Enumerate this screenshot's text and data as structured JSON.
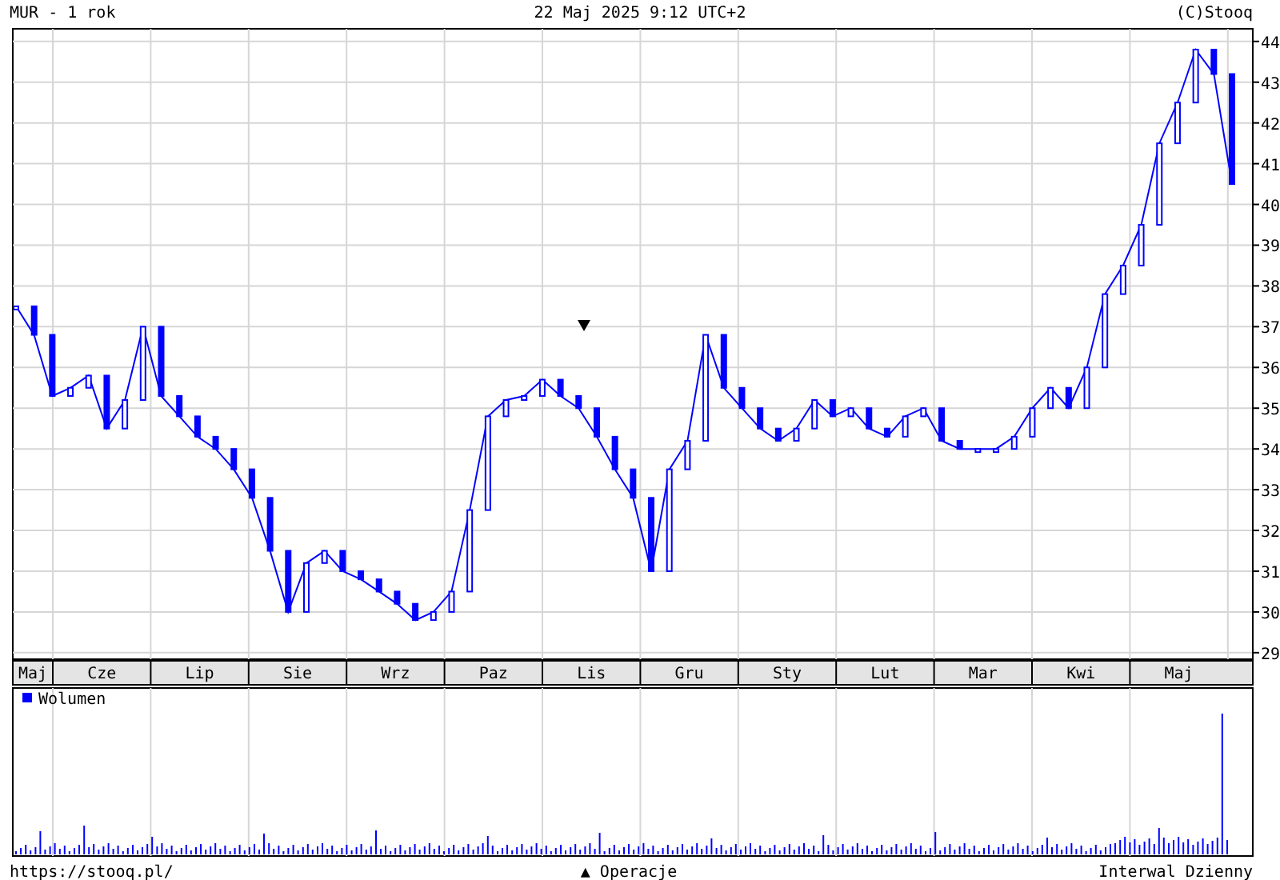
{
  "header": {
    "title": "MUR - 1 rok",
    "timestamp": "22 Maj 2025 9:12 UTC+2",
    "copyright": "(C)Stooq"
  },
  "chart": {
    "month_labels": [
      "Maj",
      "Cze",
      "Lip",
      "Sie",
      "Wrz",
      "Paz",
      "Lis",
      "Gru",
      "Sty",
      "Lut",
      "Mar",
      "Kwi",
      "Maj"
    ],
    "chart_data": {
      "type": "line",
      "grid": true,
      "ylim": [
        28.84,
        44.31
      ],
      "yticks": [
        29,
        30,
        31,
        32,
        33,
        34,
        35,
        36,
        37,
        38,
        39,
        40,
        41,
        42,
        43,
        44
      ],
      "series": [
        {
          "color": "#0000ff",
          "values": [
            37.5,
            36.8,
            35.3,
            35.5,
            35.8,
            34.5,
            35.2,
            37.0,
            35.3,
            34.8,
            34.3,
            34.0,
            33.5,
            32.8,
            31.5,
            30.0,
            31.2,
            31.5,
            31.0,
            30.8,
            30.5,
            30.2,
            29.8,
            30.0,
            30.5,
            32.5,
            34.8,
            35.2,
            35.3,
            35.7,
            35.3,
            35.0,
            34.3,
            33.5,
            32.8,
            31.0,
            33.5,
            34.2,
            36.8,
            35.5,
            35.0,
            34.5,
            34.2,
            34.5,
            35.2,
            34.8,
            35.0,
            34.5,
            34.3,
            34.8,
            35.0,
            34.2,
            34.0,
            34.0,
            34.0,
            34.3,
            35.0,
            35.5,
            35.0,
            36.0,
            37.8,
            38.5,
            39.5,
            41.5,
            42.5,
            43.8,
            43.2,
            40.5
          ]
        }
      ]
    }
  },
  "volume_panel": {
    "legend": "Wolumen"
  },
  "footer": {
    "url": "https://stooq.pl/",
    "operations": "▲ Operacje",
    "interval": "Interwal Dzienny"
  }
}
